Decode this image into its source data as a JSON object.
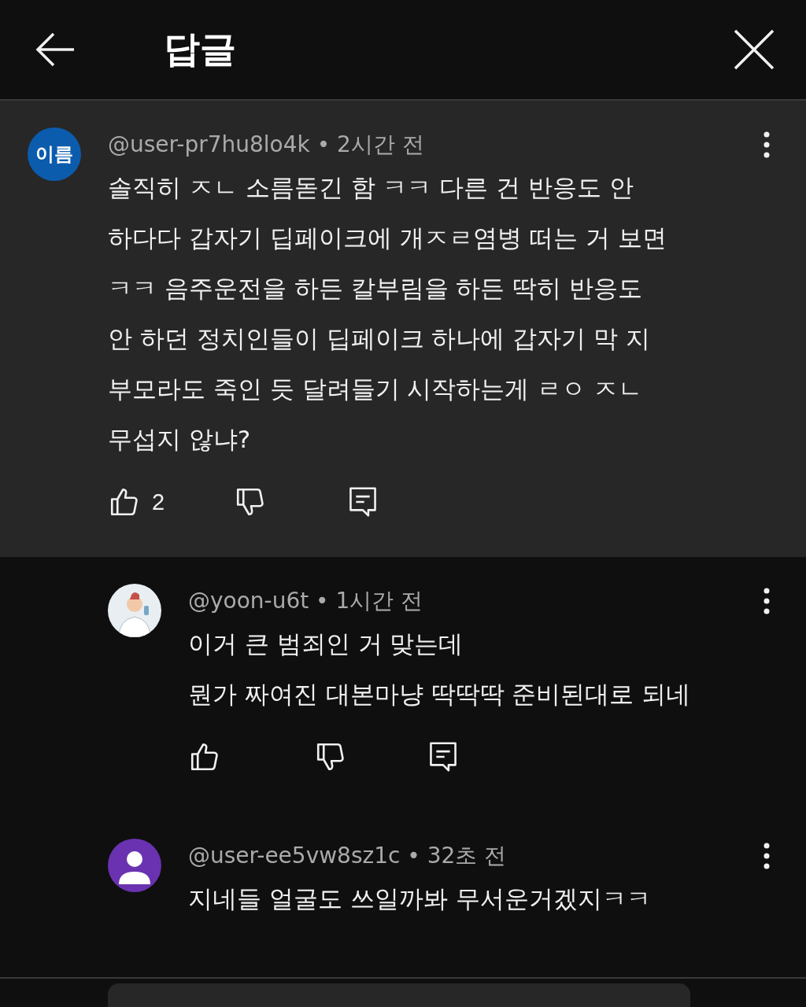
{
  "header": {
    "title": "답글"
  },
  "comment": {
    "avatar_text": "이름",
    "meta": "@user-pr7hu8lo4k • 2시간 전",
    "text": "솔직히 ㅈㄴ 소름돋긴 함 ㅋㅋ 다른 건 반응도 안\n하다다 갑자기 딥페이크에 개ㅈㄹ염병 떠는 거 보면\nㅋㅋ 음주운전을 하든 칼부림을 하든 딱히 반응도\n안 하던 정치인들이 딥페이크 하나에 갑자기 막 지\n부모라도 죽인 듯 달려들기 시작하는게 ㄹㅇ ㅈㄴ\n무섭지 않냐?",
    "likes": "2"
  },
  "replies": [
    {
      "kind": "illustration",
      "meta": "@yoon-u6t • 1시간 전",
      "text": "이거 큰 범죄인 거 맞는데\n뭔가 짜여진 대본마냥 딱딱딱 준비된대로 되네"
    },
    {
      "kind": "default",
      "meta": "@user-ee5vw8sz1c • 32초 전",
      "text": "지네들 얼굴도 쓰일까봐 무서운거겠지ㅋㅋ"
    }
  ]
}
